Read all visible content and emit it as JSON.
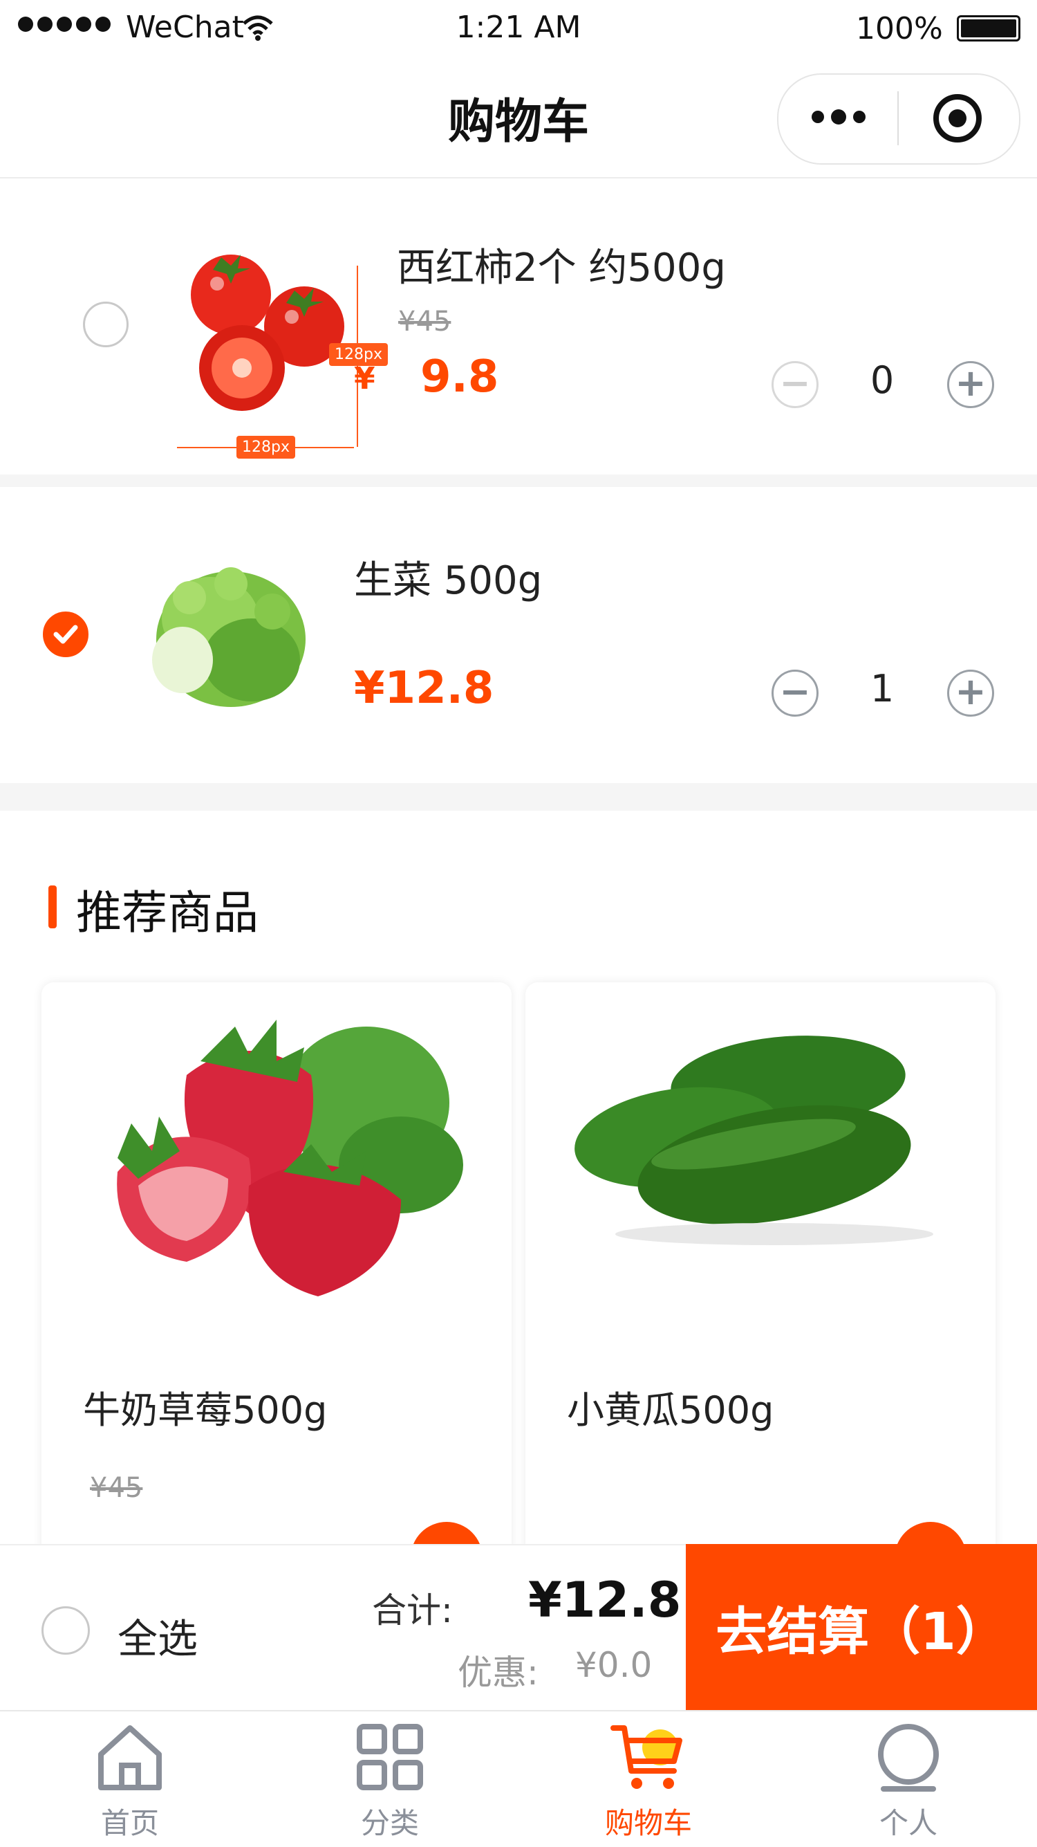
{
  "status_bar": {
    "carrier": "WeChat",
    "time": "1:21 AM",
    "battery": "100%"
  },
  "nav": {
    "title": "购物车"
  },
  "cart_items": [
    {
      "title": "西红柿2个 约500g",
      "original_price": "¥45",
      "currency": "¥",
      "price": "9.8",
      "quantity": "0",
      "selected": false,
      "image_width_label": "128px",
      "image_height_label": "128px"
    },
    {
      "title": "生菜 500g",
      "price": "¥12.8",
      "quantity": "1",
      "selected": true
    }
  ],
  "recommend": {
    "title": "推荐商品",
    "products": [
      {
        "name": "牛奶草莓500g",
        "original_price": "¥45"
      },
      {
        "name": "小黄瓜500g"
      }
    ]
  },
  "summary": {
    "select_all": "全选",
    "total_label": "合计:",
    "total": "¥12.8",
    "discount_label": "优惠:",
    "discount": "¥0.0",
    "checkout": "去结算（1）"
  },
  "tabbar": [
    {
      "label": "首页",
      "icon": "home-icon",
      "active": false
    },
    {
      "label": "分类",
      "icon": "category-icon",
      "active": false
    },
    {
      "label": "购物车",
      "icon": "cart-icon",
      "active": true
    },
    {
      "label": "个人",
      "icon": "profile-icon",
      "active": false
    }
  ],
  "colors": {
    "accent": "#ff4800",
    "muted": "#8a8f99",
    "separator": "#f5f5f5"
  }
}
